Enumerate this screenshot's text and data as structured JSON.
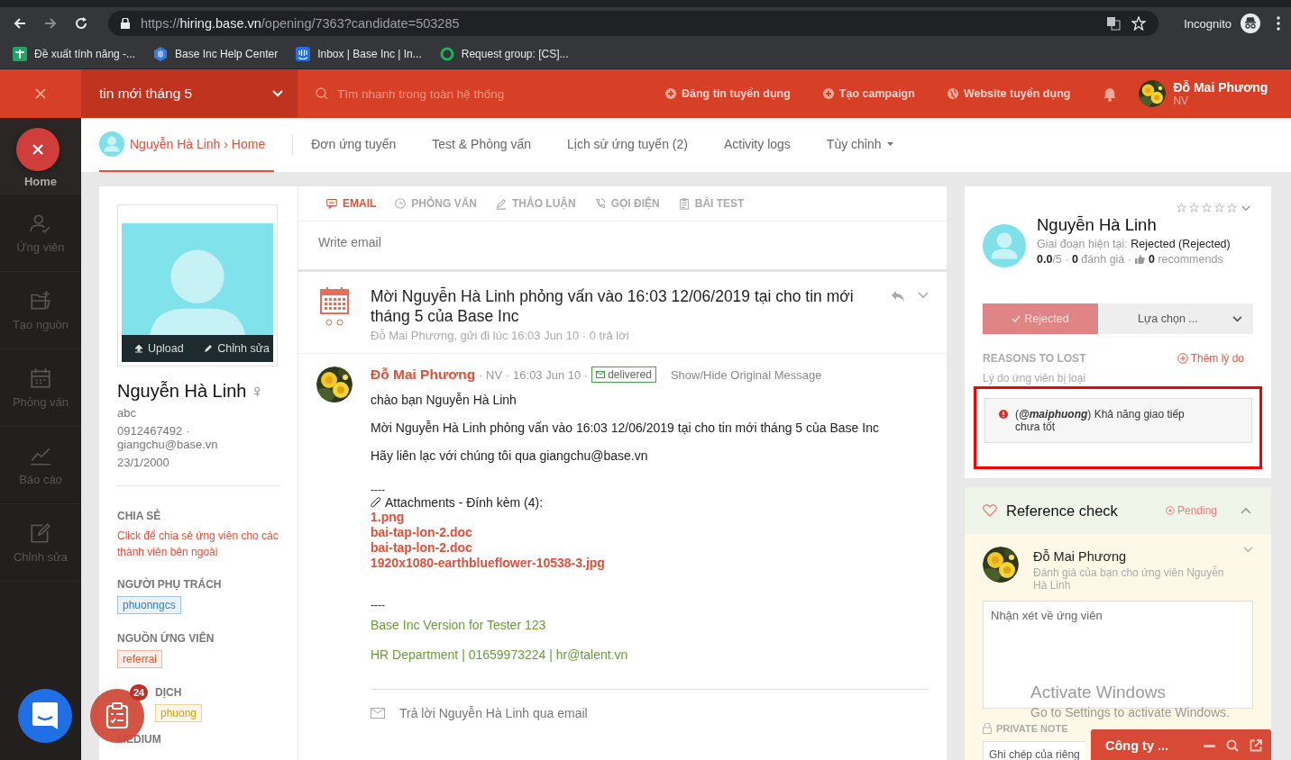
{
  "browser": {
    "scheme": "https://",
    "host": "hiring.base.vn",
    "path": "/opening/7363?candidate=503285",
    "profile": "Incognito",
    "bookmarks": [
      {
        "label": "Đề xuất tính năng -...",
        "kind": "sheet"
      },
      {
        "label": "Base Inc Help Center",
        "kind": "hex"
      },
      {
        "label": "Inbox | Base Inc | In...",
        "kind": "inbox"
      },
      {
        "label": "Request group: [CS]...",
        "kind": "ring"
      }
    ]
  },
  "app_header": {
    "job": "tin mới tháng 5",
    "search_placeholder": "Tìm nhanh trong toàn hệ thống",
    "actions": [
      {
        "label": "Đăng tin tuyển dụng",
        "kind": "plus"
      },
      {
        "label": "Tạo campaign",
        "kind": "plus"
      },
      {
        "label": "Website tuyển dụng",
        "kind": "globe"
      }
    ],
    "user": {
      "name": "Đỗ Mai Phương",
      "role": "NV"
    }
  },
  "sidebar": {
    "items": [
      {
        "label": "Home",
        "selected": true
      },
      {
        "label": "Ứng viên",
        "kind": "person",
        "selected": false
      },
      {
        "label": "Tạo nguồn",
        "kind": "folder",
        "selected": false
      },
      {
        "label": "Phỏng vấn",
        "kind": "calendar",
        "selected": false
      },
      {
        "label": "Báo cáo",
        "kind": "chart",
        "selected": false
      },
      {
        "label": "Chỉnh sửa",
        "kind": "edit",
        "selected": false
      }
    ]
  },
  "tabs": [
    {
      "label": "Nguyễn Hà Linh › Home",
      "kind": "profile",
      "selected": true
    },
    {
      "label": "Đơn ứng tuyển",
      "kind": "plain",
      "selected": false
    },
    {
      "label": "Test & Phỏng vấn",
      "kind": "plain",
      "selected": false
    },
    {
      "label": "Lịch sử ứng tuyển (2)",
      "kind": "plain",
      "selected": false
    },
    {
      "label": "Activity logs",
      "kind": "plain",
      "selected": false
    },
    {
      "label": "Tùy chỉnh",
      "kind": "menu",
      "selected": false
    }
  ],
  "profile": {
    "upload": "Upload",
    "edit": "Chỉnh sửa",
    "name": "Nguyễn Hà Linh",
    "gender": "♀",
    "note": "abc",
    "contact": "0912467492 · giangchu@base.vn",
    "birthday": "23/1/2000",
    "share_label": "CHIA SẺ",
    "share_link": "Click để chia sẻ ứng viên cho các thành viên bên ngoài",
    "sections": [
      {
        "label": "NGƯỜI PHỤ TRÁCH",
        "tag": "phuonngcs",
        "color": "#2f7fbf"
      },
      {
        "label": "NGUỒN ỨNG VIÊN",
        "tag": "referral",
        "color": "#e0592a"
      },
      {
        "label": "DỊCH",
        "tag": "phuong",
        "color": "#d4a20a"
      }
    ],
    "cut_label": "MEDIUM"
  },
  "activity": {
    "tabs": [
      {
        "label": "EMAIL",
        "kind": "chat",
        "selected": true
      },
      {
        "label": "PHỎNG VẤN",
        "kind": "clock",
        "selected": false
      },
      {
        "label": "THẢO LUẬN",
        "kind": "pen",
        "selected": false
      },
      {
        "label": "GỌI ĐIỆN",
        "kind": "phone",
        "selected": false
      },
      {
        "label": "BÀI TEST",
        "kind": "clipboard",
        "selected": false
      }
    ],
    "compose_placeholder": "Write email"
  },
  "thread": {
    "title": "Mời Nguyễn Hà Linh phỏng vấn vào 16:03 12/06/2019 tại cho tin mới tháng 5 của Base Inc",
    "meta": "Đỗ Mai Phương, gửi đi lúc 16:03 Jun 10 · 0 trả lời",
    "message": {
      "author": "Đỗ Mai Phương",
      "role": "· NV ·",
      "time": "16:03 Jun 10 ·",
      "status": "delivered",
      "toggle": "Show/Hide Original Message",
      "body": [
        "chào bạn Nguyễn Hà Linh",
        "Mời Nguyễn Hà Linh phỏng vấn vào 16:03 12/06/2019 tại cho tin mới tháng 5 của Base Inc",
        "Hãy liên lạc với chúng tôi qua giangchu@base.vn"
      ],
      "separator": "----",
      "attachments_label": "Attachments - Đính kèm (4):",
      "files": [
        "1.png",
        "bai-tap-lon-2.doc",
        "bai-tap-lon-2.doc",
        "1920x1080-earthblueflower-10538-3.jpg"
      ],
      "signature_separator": "----",
      "signature": [
        "Base Inc Version for Tester 123",
        "HR Department | 01659973224 | hr@talent.vn"
      ]
    },
    "reply_prompt": "Trả lời Nguyễn Hà Linh qua email"
  },
  "candidate": {
    "stars": 0,
    "name": "Nguyễn Hà Linh",
    "stage": "Giai đoạn hiện tại: **Rejected (Rejected)**",
    "rating": "**0.0**/5 · **0** đánh giá ·",
    "recommends": "**0** recommends",
    "status_button": "Rejected",
    "choose_button": "Lựa chọn ...",
    "reasons_label": "REASONS TO LOST",
    "add_reason": "Thêm lý do",
    "reasons_hint": "Lý do ứng viên bị loại",
    "reason": "(**@maiphuong**) Khả năng giao tiếp chưa tốt"
  },
  "reference_check": {
    "title": "Reference check",
    "status": "Pending",
    "expanded": true,
    "reviewer": "Đỗ Mai Phương",
    "subtitle": "Đánh giá của bạn cho ứng viên Nguyễn Hà Linh",
    "comment_placeholder": "Nhận xét về ứng viên",
    "private_label": "PRIVATE NOTE",
    "private_placeholder": "Ghi chép của riêng"
  },
  "chat_bar": {
    "title": "Công ty ..."
  },
  "task_badge": "24",
  "os_notice": {
    "title": "Activate Windows",
    "text": "Go to Settings to activate Windows."
  }
}
